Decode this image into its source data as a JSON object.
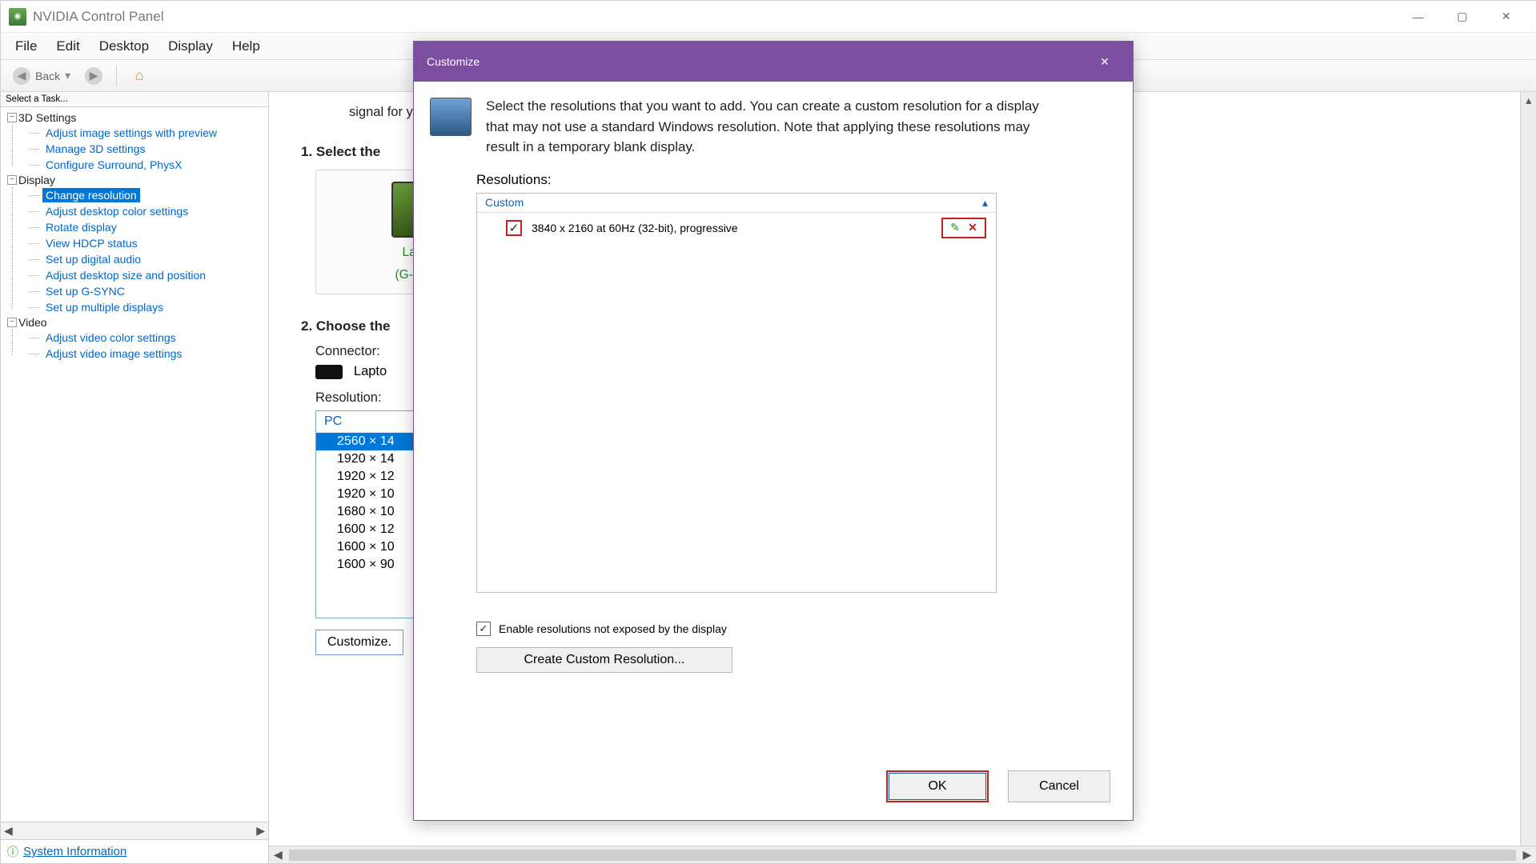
{
  "window": {
    "title": "NVIDIA Control Panel"
  },
  "menubar": [
    "File",
    "Edit",
    "Desktop",
    "Display",
    "Help"
  ],
  "toolbar": {
    "back": "Back"
  },
  "sidebar": {
    "header": "Select a Task...",
    "groups": [
      {
        "label": "3D Settings",
        "items": [
          "Adjust image settings with preview",
          "Manage 3D settings",
          "Configure Surround, PhysX"
        ]
      },
      {
        "label": "Display",
        "items": [
          "Change resolution",
          "Adjust desktop color settings",
          "Rotate display",
          "View HDCP status",
          "Set up digital audio",
          "Adjust desktop size and position",
          "Set up G-SYNC",
          "Set up multiple displays"
        ]
      },
      {
        "label": "Video",
        "items": [
          "Adjust video color settings",
          "Adjust video image settings"
        ]
      }
    ],
    "selected": "Change resolution",
    "sysinfo": "System Information"
  },
  "content": {
    "intro_fragment": "signal for your",
    "step1_title": "1. Select the",
    "monitor_line1": "Laptop D",
    "monitor_line2": "(G-SYNC C",
    "step2_title": "2. Choose the",
    "connector_label": "Connector:",
    "connector_value": "Lapto",
    "resolution_label": "Resolution:",
    "res_group": "PC",
    "res_items": [
      "2560 × 14",
      "1920 × 14",
      "1920 × 12",
      "1920 × 10",
      "1680 × 10",
      "1600 × 12",
      "1600 × 10",
      "1600 × 90"
    ],
    "res_selected_index": 0,
    "customize_btn": "Customize."
  },
  "modal": {
    "title": "Customize",
    "info": "Select the resolutions that you want to add. You can create a custom resolution for a display that may not use a standard Windows resolution. Note that applying these resolutions may result in a temporary blank display.",
    "res_label": "Resolutions:",
    "group_label": "Custom",
    "entry_checked": true,
    "entry_text": "3840 x 2160 at 60Hz (32-bit), progressive",
    "enable_chk": true,
    "enable_label": "Enable resolutions not exposed by the display",
    "create_btn": "Create Custom Resolution...",
    "ok": "OK",
    "cancel": "Cancel"
  }
}
